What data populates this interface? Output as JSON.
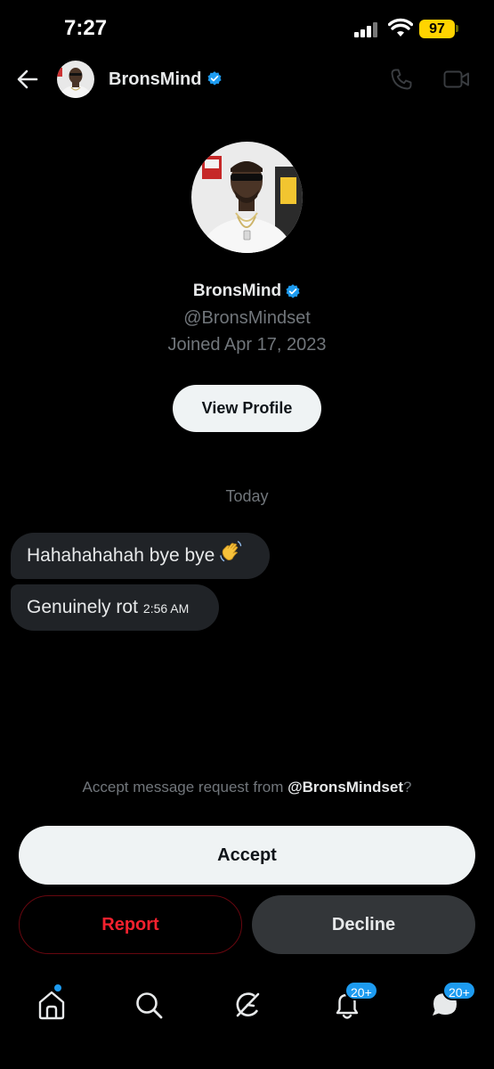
{
  "status_bar": {
    "time": "7:27",
    "battery": "97"
  },
  "header": {
    "display_name": "BronsMind"
  },
  "profile": {
    "display_name": "BronsMind",
    "handle": "@BronsMindset",
    "joined": "Joined Apr 17, 2023",
    "view_profile_label": "View Profile"
  },
  "conversation": {
    "day_label": "Today",
    "messages": [
      {
        "text": "Hahahahahah bye bye",
        "emoji": "waving-hand"
      },
      {
        "text": "Genuinely rot",
        "time": "2:56 AM"
      }
    ]
  },
  "request": {
    "prompt_prefix": "Accept message request from ",
    "prompt_handle": "@BronsMindset",
    "prompt_suffix": "?",
    "accept_label": "Accept",
    "report_label": "Report",
    "decline_label": "Decline"
  },
  "bottom_nav": {
    "items": [
      "home-icon",
      "search-icon",
      "grok-icon",
      "notifications-icon",
      "messages-icon"
    ],
    "notifications_badge": "20+",
    "messages_badge": "20+"
  },
  "colors": {
    "accent": "#1d9bf0",
    "background": "#000000",
    "bubble": "#202327",
    "danger": "#f4212e",
    "battery": "#ffd400"
  }
}
